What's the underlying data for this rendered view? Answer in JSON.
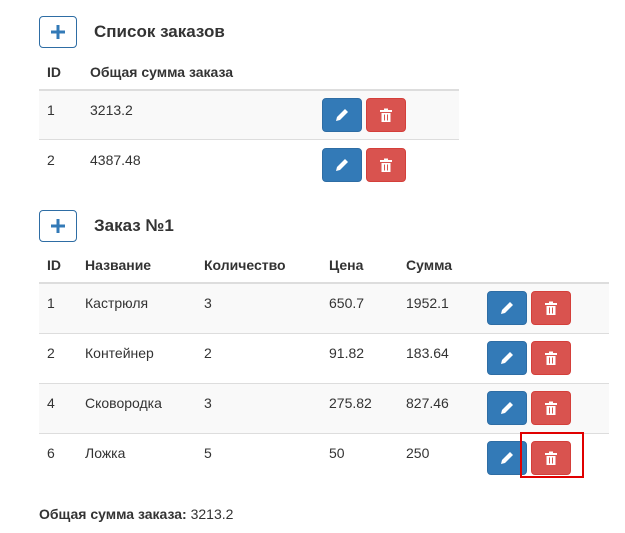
{
  "orders": {
    "title": "Список заказов",
    "columns": {
      "id": "ID",
      "total": "Общая сумма заказа"
    },
    "rows": [
      {
        "id": "1",
        "total": "3213.2"
      },
      {
        "id": "2",
        "total": "4387.48"
      }
    ]
  },
  "order": {
    "title": "Заказ №1",
    "columns": {
      "id": "ID",
      "name": "Название",
      "qty": "Количество",
      "price": "Цена",
      "sum": "Сумма"
    },
    "rows": [
      {
        "id": "1",
        "name": "Кастрюля",
        "qty": "3",
        "price": "650.7",
        "sum": "1952.1"
      },
      {
        "id": "2",
        "name": "Контейнер",
        "qty": "2",
        "price": "91.82",
        "sum": "183.64"
      },
      {
        "id": "4",
        "name": "Сковородка",
        "qty": "3",
        "price": "275.82",
        "sum": "827.46"
      },
      {
        "id": "6",
        "name": "Ложка",
        "qty": "5",
        "price": "50",
        "sum": "250"
      }
    ]
  },
  "footer": {
    "total_label": "Общая сумма заказа:",
    "total_value": "3213.2"
  },
  "icons": {
    "add": "plus-icon",
    "edit": "pencil-icon",
    "delete": "trash-icon"
  },
  "colors": {
    "primary": "#337ab7",
    "danger": "#d9534f",
    "highlight": "#e00000"
  }
}
